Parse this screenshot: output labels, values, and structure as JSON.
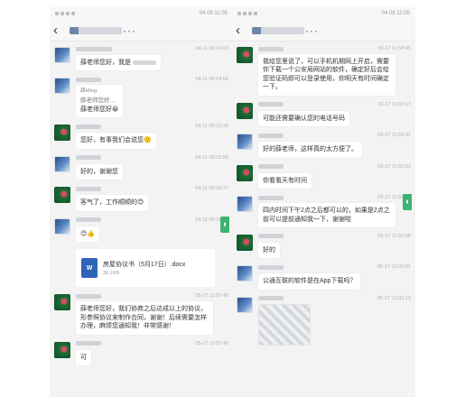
{
  "left": {
    "status_time": "04 09 11:05",
    "chat_title": "",
    "messages": [
      {
        "time": "04-11 09:14:03",
        "text": "薛老师您好，我是"
      },
      {
        "time": "04-11 09:14:56",
        "quote_name": "薛Ming",
        "quote_text": "薛老师您好…",
        "text": "薛老师您好😀"
      },
      {
        "time": "04-11 09:15:38",
        "text": "您好，有事我们会说您🙂"
      },
      {
        "time": "04-11 09:15:56",
        "text": "好的，谢谢您"
      },
      {
        "time": "04-11 09:16:27",
        "text": "客气了，工作顺顺的😊"
      },
      {
        "time": "04-11 09:16:45",
        "text": "😊👍"
      },
      {
        "file_name": "房屋协议书（5月17日）.docx",
        "file_size": "38.1KB",
        "file_icon": "W"
      },
      {
        "time": "05-17 11:57:49",
        "text": "薛老师您好，我们协商之后达成以上的协议，形参照协议来制作合同，谢谢！后续需要怎样办理，麻烦您通知我！非常感谢！"
      },
      {
        "time": "05-17 11:57:49",
        "text": "可"
      }
    ]
  },
  "right": {
    "status_time": "04 09 11:05",
    "chat_title": "",
    "messages": [
      {
        "time": "05-17 11:58:45",
        "text": "我给您里说了，可以手机机期网上开启，需要你下载一个公安局网站的软件，确定好后会给您验证码即可以登录使用，你明天有时间确定一下。"
      },
      {
        "time": "05-17 11:59:17",
        "text": "可能还需要确认您的电话号码"
      },
      {
        "time": "05-17 11:59:31",
        "text": "好的薛老师，这样真的太方便了。"
      },
      {
        "time": "05-17 11:59:51",
        "text": "你看看天有时间"
      },
      {
        "time": "05-17 11:59:56",
        "text": "四内时间下午2点之后都可以的，如果是2点之前可以提前通知我一下，谢谢啦"
      },
      {
        "time": "05-17 11:59:56",
        "text": "好的"
      },
      {
        "time": "05-17 12:00:01",
        "text": "公通互联的软件是在App下载吗？"
      },
      {
        "time": "05-17 12:00:10",
        "text": ""
      }
    ]
  }
}
